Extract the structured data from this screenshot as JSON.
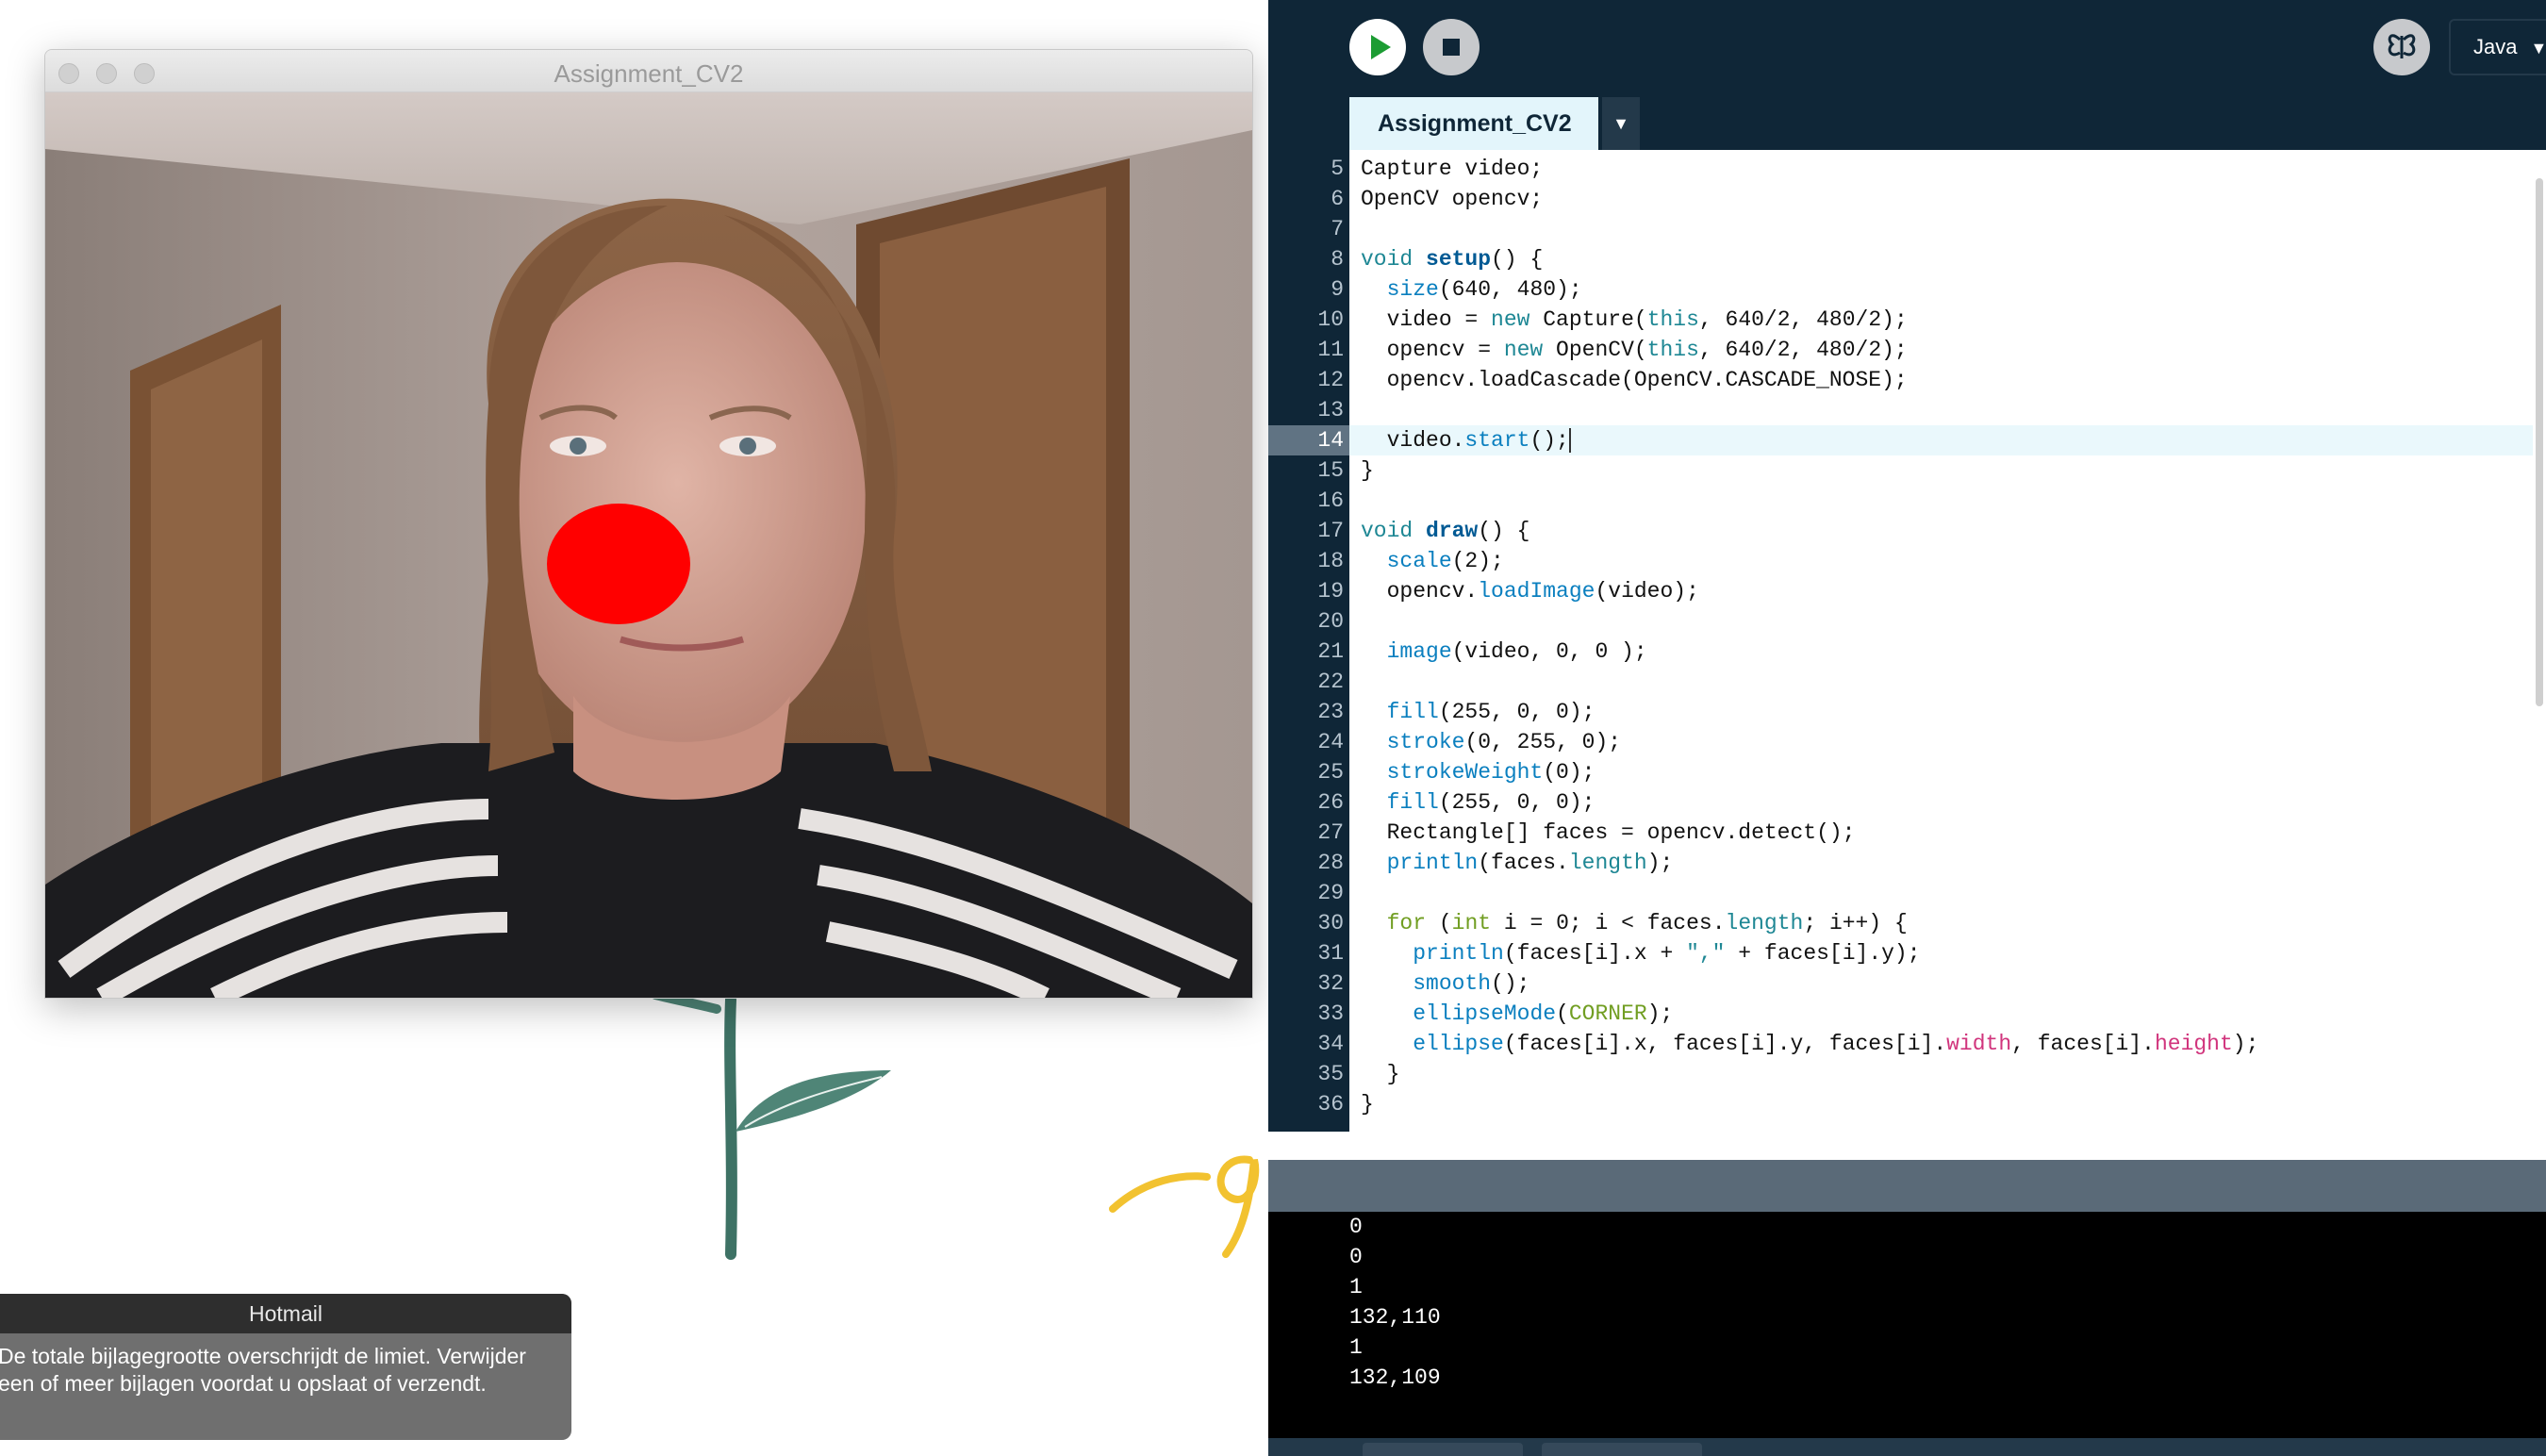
{
  "sketch_window": {
    "title": "Assignment_CV2"
  },
  "notification": {
    "app": "Hotmail",
    "message_line1": "De totale bijlagegrootte overschrijdt de limiet. Verwijder",
    "message_line2": "een of meer bijlagen voordat u opslaat of verzendt."
  },
  "ide": {
    "mode_label": "Java",
    "mode_arrow": "▼",
    "tab_label": "Assignment_CV2",
    "tab_menu_arrow": "▼",
    "colors": {
      "background": "#0f2637",
      "tab": "#e3f5fb",
      "accent": "#1e8794"
    }
  },
  "editor": {
    "current_line": 14,
    "lines": [
      {
        "no": "5"
      },
      {
        "no": "6"
      },
      {
        "no": "7"
      },
      {
        "no": "8"
      },
      {
        "no": "9"
      },
      {
        "no": "10"
      },
      {
        "no": "11"
      },
      {
        "no": "12"
      },
      {
        "no": "13"
      },
      {
        "no": "14"
      },
      {
        "no": "15"
      },
      {
        "no": "16"
      },
      {
        "no": "17"
      },
      {
        "no": "18"
      },
      {
        "no": "19"
      },
      {
        "no": "20"
      },
      {
        "no": "21"
      },
      {
        "no": "22"
      },
      {
        "no": "23"
      },
      {
        "no": "24"
      },
      {
        "no": "25"
      },
      {
        "no": "26"
      },
      {
        "no": "27"
      },
      {
        "no": "28"
      },
      {
        "no": "29"
      },
      {
        "no": "30"
      },
      {
        "no": "31"
      },
      {
        "no": "32"
      },
      {
        "no": "33"
      },
      {
        "no": "34"
      },
      {
        "no": "35"
      },
      {
        "no": "36"
      }
    ],
    "code": {
      "l5_a": "Capture video;",
      "l6_a": "OpenCV opencv;",
      "l8_a": "void ",
      "l8_b": "setup",
      "l8_c": "() {",
      "l9_a": "  ",
      "l9_b": "size",
      "l9_c": "(640, 480);",
      "l10_a": "  video = ",
      "l10_b": "new",
      "l10_c": " Capture(",
      "l10_d": "this",
      "l10_e": ", 640/2, 480/2);",
      "l11_a": "  opencv = ",
      "l11_b": "new",
      "l11_c": " OpenCV(",
      "l11_d": "this",
      "l11_e": ", 640/2, 480/2);",
      "l12_a": "  opencv.loadCascade(OpenCV.CASCADE_NOSE);",
      "l14_a": "  video.",
      "l14_b": "start",
      "l14_c": "();",
      "l15_a": "}",
      "l17_a": "void ",
      "l17_b": "draw",
      "l17_c": "() {",
      "l18_a": "  ",
      "l18_b": "scale",
      "l18_c": "(2);",
      "l19_a": "  opencv.",
      "l19_b": "loadImage",
      "l19_c": "(video);",
      "l21_a": "  ",
      "l21_b": "image",
      "l21_c": "(video, 0, 0 );",
      "l23_a": "  ",
      "l23_b": "fill",
      "l23_c": "(255, 0, 0);",
      "l24_a": "  ",
      "l24_b": "stroke",
      "l24_c": "(0, 255, 0);",
      "l25_a": "  ",
      "l25_b": "strokeWeight",
      "l25_c": "(0);",
      "l26_a": "  ",
      "l26_b": "fill",
      "l26_c": "(255, 0, 0);",
      "l27_a": "  Rectangle[] faces = opencv.detect();",
      "l28_a": "  ",
      "l28_b": "println",
      "l28_c": "(faces.",
      "l28_d": "length",
      "l28_e": ");",
      "l30_a": "  ",
      "l30_b": "for",
      "l30_c": " (",
      "l30_d": "int",
      "l30_e": " i = 0; i < faces.",
      "l30_f": "length",
      "l30_g": "; i++) {",
      "l31_a": "    ",
      "l31_b": "println",
      "l31_c": "(faces[i].x + ",
      "l31_d": "\",\"",
      "l31_e": " + faces[i].y);",
      "l32_a": "    ",
      "l32_b": "smooth",
      "l32_c": "();",
      "l33_a": "    ",
      "l33_b": "ellipseMode",
      "l33_c": "(",
      "l33_d": "CORNER",
      "l33_e": ");",
      "l34_a": "    ",
      "l34_b": "ellipse",
      "l34_c": "(faces[i].x, faces[i].y, faces[i].",
      "l34_d": "width",
      "l34_e": ", faces[i].",
      "l34_f": "height",
      "l34_g": ");",
      "l35_a": "  }",
      "l36_a": "}"
    }
  },
  "console": {
    "lines": [
      "0",
      "0",
      "1",
      "132,110",
      "1",
      "132,109"
    ]
  }
}
